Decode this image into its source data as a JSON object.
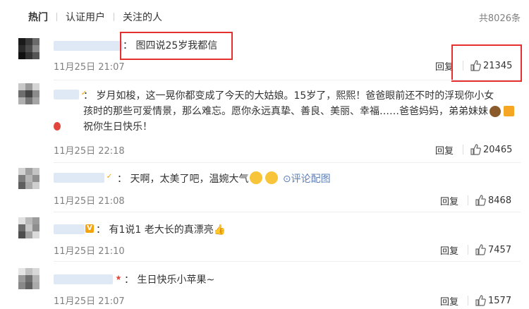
{
  "tabs": [
    "热门",
    "认证用户",
    "关注的人"
  ],
  "total_comments": "共8026条",
  "comments": [
    {
      "text": "：  图四说25岁我都信",
      "time": "11月25日 21:07",
      "reply": "回复",
      "likes": "21345"
    },
    {
      "text": "：  岁月如梭，这一晃你都变成了今天的大姑娘。15岁了，熙熙！爸爸眼前还不时的浮现你小女孩时的那些可爱情景，那么难忘。愿你永远真挚、善良、美丽、幸福……爸爸妈妈，弟弟妹妹祝你生日快乐！",
      "time": "11月25日 22:18",
      "reply": "回复",
      "likes": "20465"
    },
    {
      "text": "：  天啊，太美了吧，温婉大气",
      "link": "评论配图",
      "time": "11月25日 21:08",
      "reply": "回复",
      "likes": "8468"
    },
    {
      "text": "：  有1说1 老大长的真漂亮",
      "time": "11月25日 21:10",
      "reply": "回复",
      "likes": "7457"
    },
    {
      "text": "：  生日快乐小苹果~",
      "time": "11月25日 21:07",
      "reply": "回复",
      "likes": "1577"
    }
  ],
  "colors": {
    "highlight_box": "#e53030",
    "link": "#5b7fb7",
    "meta_gray": "#808080"
  },
  "icons": [
    "thumbs-up-icon",
    "cake-icon",
    "gift-icon",
    "balloon-icon",
    "blush-emoji-icon",
    "verified-v-icon"
  ]
}
